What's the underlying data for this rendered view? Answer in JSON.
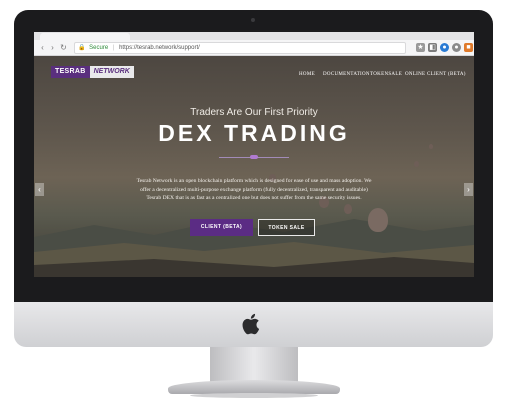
{
  "browser": {
    "secure_label": "Secure",
    "url": "https://tesrab.network/support/"
  },
  "site": {
    "brand_part1": "TESRAB",
    "brand_part2": "NETWORK",
    "nav": [
      "HOME",
      "DOCUMENTATION",
      "TOKENSALE",
      "ONLINE CLIENT (BETA)"
    ],
    "tagline": "Traders Are Our First Priority",
    "headline": "DEX TRADING",
    "description": "Tesrab Network is an open blockchain platform which is designed for ease of use and mass adoption. We offer a decentralized multi-purpose exchange platform (fully decentralized, transparent and auditable) Tesrab DEX that is as fast as a centralized one but does not suffer from the same security issues.",
    "buttons": {
      "client": "CLIENT (BETA)",
      "token_sale": "TOKEN SALE"
    },
    "colors": {
      "accent": "#5b2c84"
    }
  }
}
